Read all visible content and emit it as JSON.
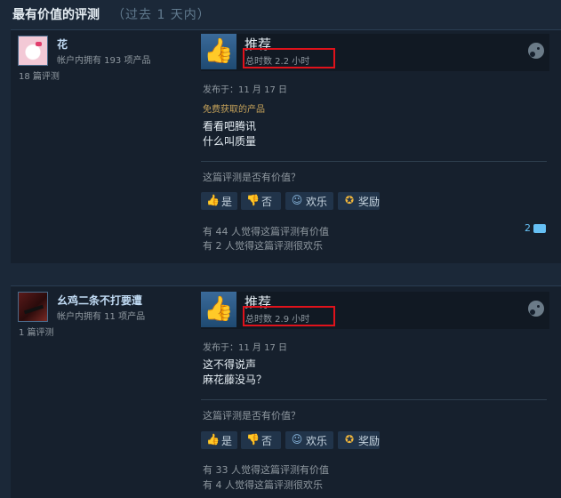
{
  "header": {
    "title": "最有价值的评测",
    "subtitle": "（过去 1 天内）"
  },
  "reviews": [
    {
      "author": {
        "name": "花",
        "products": "帐户内拥有 193 项产品",
        "review_count": "18 篇评测"
      },
      "verdict": "推荐",
      "hours": "总时数 2.2 小时",
      "posted": "发布于：11 月 17 日",
      "free_label": "免费获取的产品",
      "text": [
        "看看吧腾讯",
        "什么叫质量"
      ],
      "helpful_question": "这篇评测是否有价值？",
      "buttons": {
        "yes": "是",
        "no": "否",
        "funny": "欢乐",
        "award": "奖励"
      },
      "helpful_stat": "有 44 人觉得这篇评测有价值",
      "funny_stat": "有 2 人觉得这篇评测很欢乐",
      "comment_count": "2"
    },
    {
      "author": {
        "name": "幺鸡二条不打要遭",
        "products": "帐户内拥有 11 项产品",
        "review_count": "1 篇评测"
      },
      "verdict": "推荐",
      "hours": "总时数 2.9 小时",
      "posted": "发布于：11 月 17 日",
      "text": [
        "这不得说声",
        "麻花藤没马？"
      ],
      "helpful_question": "这篇评测是否有价值？",
      "buttons": {
        "yes": "是",
        "no": "否",
        "funny": "欢乐",
        "award": "奖励"
      },
      "helpful_stat": "有 33 人觉得这篇评测有价值",
      "funny_stat": "有 4 人觉得这篇评测很欢乐"
    }
  ],
  "icons": {
    "thumb_up": "thumbs-up-icon",
    "thumb_down": "thumbs-down-icon",
    "funny": "smiley-icon",
    "award": "award-icon",
    "platform": "steam-icon",
    "comment": "comment-icon"
  },
  "colors": {
    "highlight_box": "#e0121b",
    "link": "#66c0f4",
    "free_label": "#c7a35a"
  }
}
